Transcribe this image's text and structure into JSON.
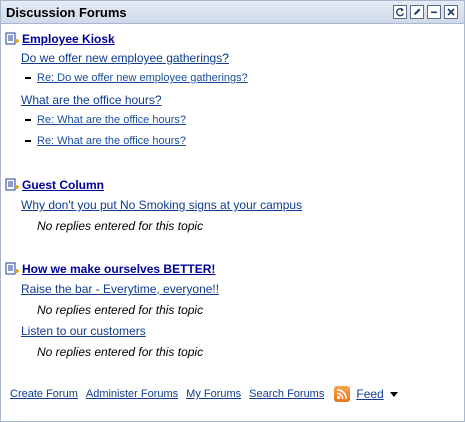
{
  "panel": {
    "title": "Discussion Forums",
    "buttons": [
      "refresh-icon",
      "edit-icon",
      "minimize-icon",
      "close-icon"
    ]
  },
  "forums": [
    {
      "name": "Employee Kiosk",
      "topics": [
        {
          "title": "Do we offer new employee gatherings?",
          "replies": [
            "Re: Do we offer new employee gatherings?"
          ]
        },
        {
          "title": "What are the office hours?",
          "replies": [
            "Re: What are the office hours?",
            "Re: What are the office hours?"
          ]
        }
      ]
    },
    {
      "name": "Guest Column",
      "topics": [
        {
          "title": "Why don't you put No Smoking signs at your campus",
          "no_replies": "No replies entered for this topic"
        }
      ]
    },
    {
      "name": "How we make ourselves BETTER!",
      "topics": [
        {
          "title": "Raise the bar - Everytime, everyone!!",
          "no_replies": "No replies entered for this topic"
        },
        {
          "title": "Listen to our customers",
          "no_replies": "No replies entered for this topic"
        }
      ]
    }
  ],
  "footer": {
    "links": [
      "Create Forum",
      "Administer Forums",
      "My Forums",
      "Search Forums"
    ],
    "feed_label": "Feed",
    "feed_icon": "rss-icon"
  }
}
